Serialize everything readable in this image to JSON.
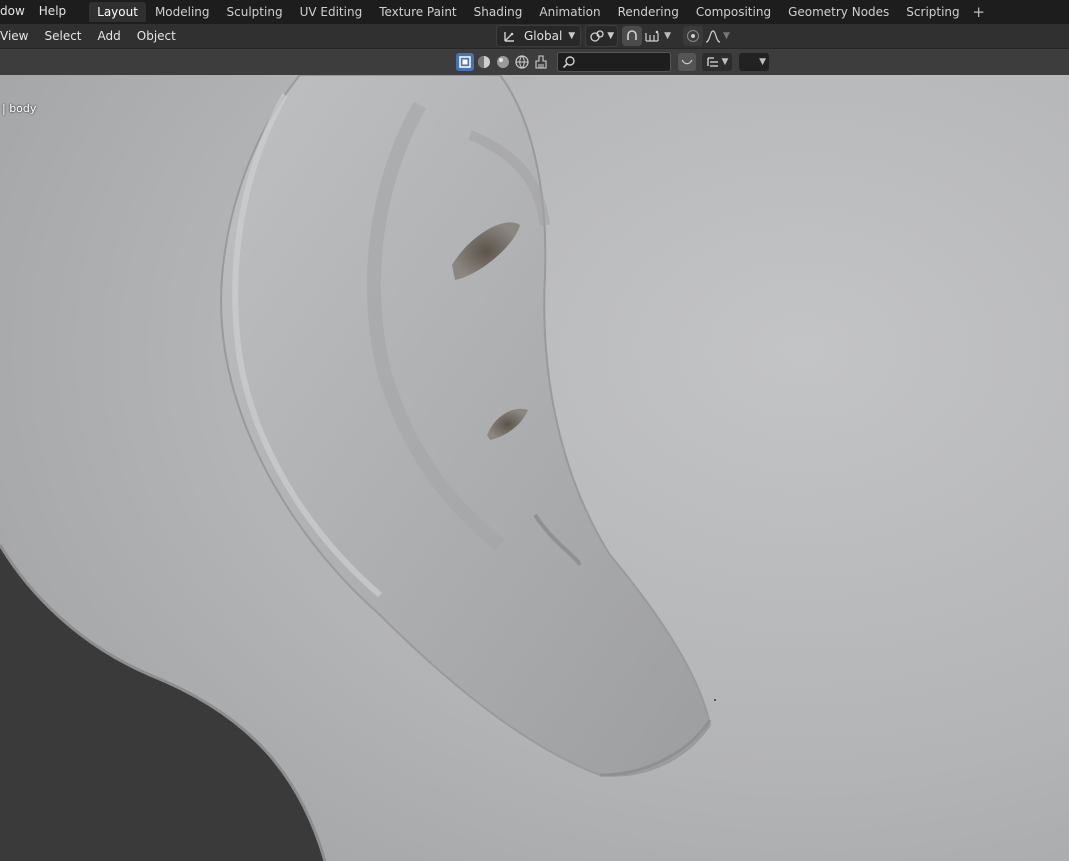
{
  "topbar": {
    "menus": [
      "dow",
      "Help"
    ],
    "workspace_tabs": [
      "Layout",
      "Modeling",
      "Sculpting",
      "UV Editing",
      "Texture Paint",
      "Shading",
      "Animation",
      "Rendering",
      "Compositing",
      "Geometry Nodes",
      "Scripting"
    ],
    "active_tab": "Layout",
    "add_label": "+"
  },
  "header": {
    "menus": [
      "View",
      "Select",
      "Add",
      "Object"
    ],
    "orientation": "Global"
  },
  "viewport": {
    "object_label": "| body"
  },
  "icons": {
    "transform-orientation": "orientation-icon",
    "pivot": "pivot-icon",
    "snap": "snap-icon",
    "proportional": "proportional-icon",
    "search": "search-icon"
  },
  "colors": {
    "accent": "#4772b3",
    "topbar_bg": "#1d1d1d",
    "header_bg": "#303030",
    "mesh": "#b8b9bb"
  }
}
